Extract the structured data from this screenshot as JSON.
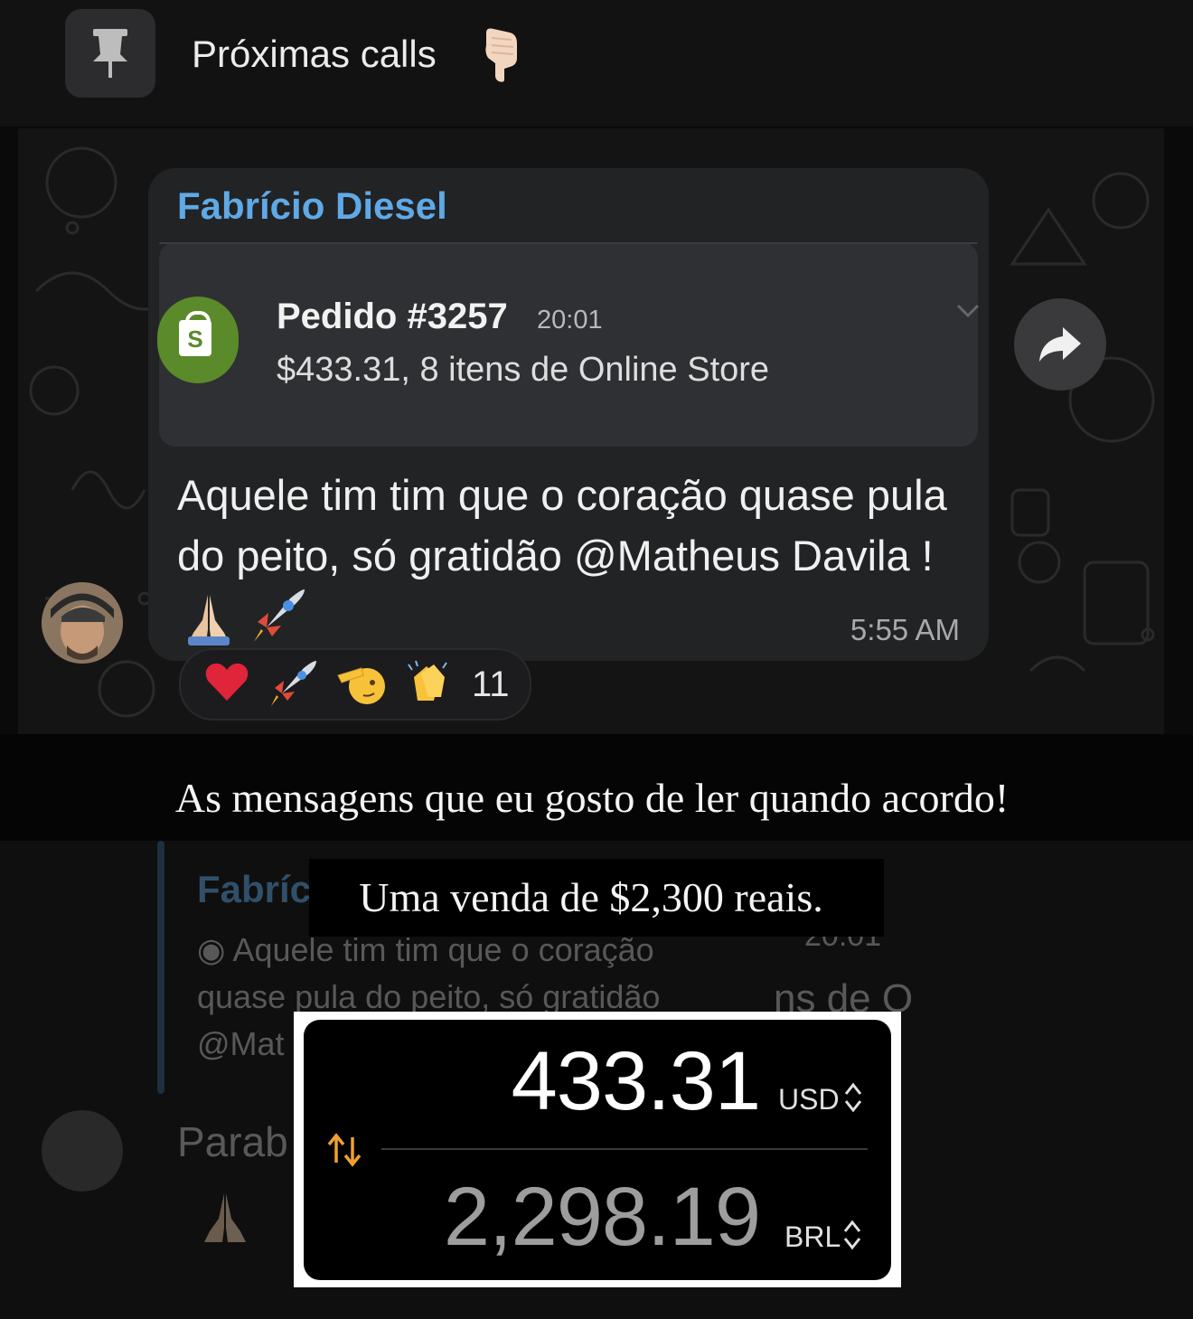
{
  "pinned": {
    "title": "Próximas calls",
    "icon": "pin-icon",
    "emoji": "pointing-down-hand"
  },
  "message": {
    "sender": "Fabrício Diesel",
    "quote": {
      "title": "Pedido #3257",
      "time": "20:01",
      "detail": "$433.31, 8 itens de Online Store",
      "icon": "shopify-bag-icon"
    },
    "text": "Aquele tim tim que o coração quase pula do peito, só gratidão @Matheus Davila !",
    "time": "5:55 AM",
    "reactions": {
      "emojis": [
        "heart",
        "rocket",
        "saluting-face",
        "clapping-hands"
      ],
      "count": "11"
    }
  },
  "caption_main": "As mensagens que eu gosto de ler quando acordo!",
  "caption_sub": "Uma venda de $2,300 reais.",
  "faded_reply": {
    "sender": "Fabríc",
    "line1": "Aquele tim tim que o coração",
    "line2": "quase pula do peito, só gratidão",
    "line3": "@Mat",
    "next_message": "Parab",
    "side_time": "20:01",
    "side_text": "ns de O"
  },
  "converter": {
    "from_value": "433.31",
    "from_currency": "USD",
    "to_value": "2,298.19",
    "to_currency": "BRL",
    "colors": {
      "accent": "#f0a030",
      "primary": "#ffffff",
      "secondary": "#9d9d9d"
    }
  },
  "colors": {
    "sender": "#5fa9e6",
    "bubble": "#222325",
    "shopify_green": "#5a8a2a"
  }
}
